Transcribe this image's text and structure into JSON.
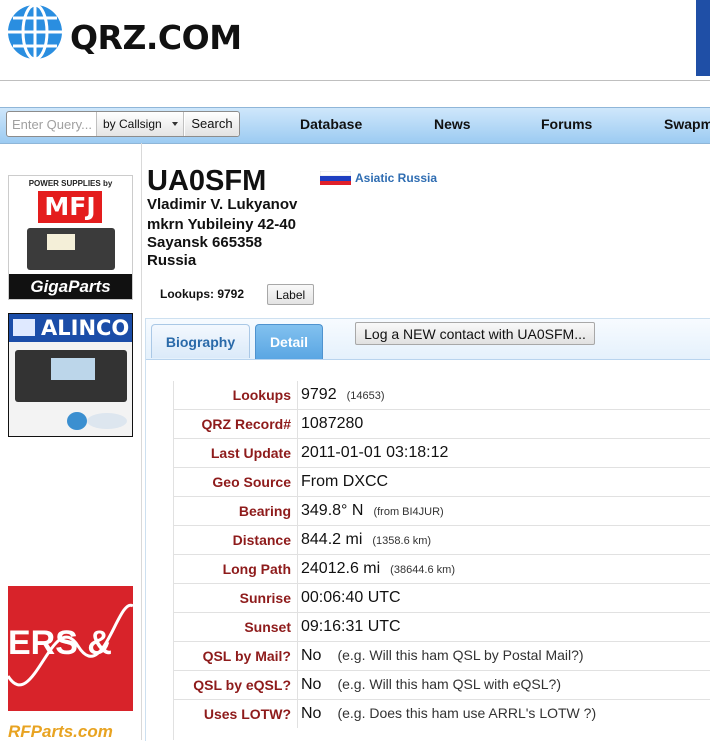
{
  "header": {
    "logo_text": "QRZ.COM",
    "accent": "#1f4fa6"
  },
  "nav": {
    "search_placeholder": "Enter Query...",
    "search_type": "by Callsign",
    "search_button": "Search",
    "links": [
      "Database",
      "News",
      "Forums",
      "Swapm"
    ]
  },
  "ads": {
    "mfj_tagline": "POWER SUPPLIES by",
    "mfj_brand": "MFJ",
    "mfj_dealer": "GigaParts",
    "alinco_brand": "ALINCO",
    "rf_text": "ERS &",
    "rf_bottom": "RFParts.com"
  },
  "profile": {
    "callsign": "UA0SFM",
    "country": "Asiatic Russia",
    "address_lines": [
      "Vladimir V. Lukyanov",
      "mkrn Yubileiny 42-40",
      "Sayansk 665358",
      "Russia"
    ],
    "lookups_label": "Lookups: 9792",
    "label_button": "Label"
  },
  "tabs": {
    "biography": "Biography",
    "detail": "Detail",
    "log_button": "Log a NEW contact with UA0SFM..."
  },
  "detail": {
    "rows": [
      {
        "key": "Lookups",
        "value": "9792",
        "sub": "(14653)",
        "hint": ""
      },
      {
        "key": "QRZ Record#",
        "value": "1087280",
        "sub": "",
        "hint": ""
      },
      {
        "key": "Last Update",
        "value": "2011-01-01 03:18:12",
        "sub": "",
        "hint": ""
      },
      {
        "key": "Geo Source",
        "value": "From DXCC",
        "sub": "",
        "hint": ""
      },
      {
        "key": "Bearing",
        "value": "349.8° N",
        "sub": "(from BI4JUR)",
        "hint": ""
      },
      {
        "key": "Distance",
        "value": "844.2 mi",
        "sub": "(1358.6 km)",
        "hint": ""
      },
      {
        "key": "Long Path",
        "value": "24012.6 mi",
        "sub": "(38644.6 km)",
        "hint": ""
      },
      {
        "key": "Sunrise",
        "value": "00:06:40 UTC",
        "sub": "",
        "hint": ""
      },
      {
        "key": "Sunset",
        "value": "09:16:31 UTC",
        "sub": "",
        "hint": ""
      },
      {
        "key": "QSL by Mail?",
        "value": "No",
        "sub": "",
        "hint": "(e.g. Will this ham QSL by Postal Mail?)"
      },
      {
        "key": "QSL by eQSL?",
        "value": "No",
        "sub": "",
        "hint": "(e.g. Will this ham QSL with eQSL?)"
      },
      {
        "key": "Uses LOTW?",
        "value": "No",
        "sub": "",
        "hint": "(e.g. Does this ham use ARRL's LOTW ?)"
      }
    ]
  }
}
